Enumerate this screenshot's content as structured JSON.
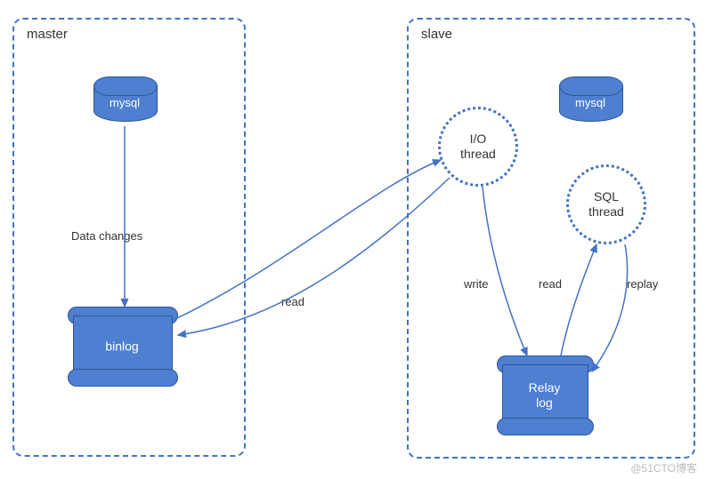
{
  "diagram": {
    "type": "mysql-replication-architecture",
    "colors": {
      "blue_border": "#4472c4",
      "blue_fill": "#4e7fd1"
    }
  },
  "master": {
    "title": "master",
    "db_label": "mysql",
    "log_label": "binlog",
    "flow_label": "Data changes"
  },
  "slave": {
    "title": "slave",
    "db_label": "mysql",
    "io_thread_label": "I/O\nthread",
    "sql_thread_label": "SQL\nthread",
    "relay_log_label": "Relay\nlog"
  },
  "arrows": {
    "read_from_binlog": "read",
    "write_to_relay": "write",
    "read_from_relay": "read",
    "replay_label": "replay"
  },
  "watermark": "@51CTO博客"
}
